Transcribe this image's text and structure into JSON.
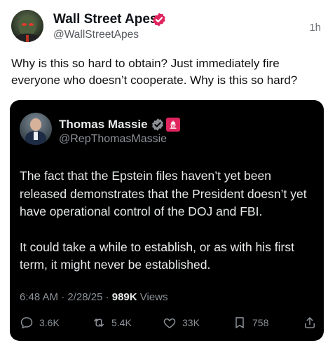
{
  "post": {
    "author_name": "Wall Street Apes",
    "handle": "@WallStreetApes",
    "time": "1h",
    "text": "Why is this so hard to obtain? Just immediately fire everyone who doesn’t cooperate. Why is this so hard?"
  },
  "quoted": {
    "author_name": "Thomas Massie",
    "handle": "@RepThomasMassie",
    "paragraph1": "The fact that the Epstein files haven’t yet been released demonstrates that the President doesn’t yet have operational control of the DOJ and FBI.",
    "paragraph2": "It could take a while to establish, or as with his first term, it might never be established.",
    "timestamp": "6:48 AM · 2/28/25 · ",
    "views_count": "989K",
    "views_label": " Views",
    "stats": {
      "replies": "3.6K",
      "reposts": "5.4K",
      "likes": "33K",
      "bookmarks": "758"
    }
  },
  "colors": {
    "verified_badge_author": "#e0245e",
    "verified_badge_quoted": "#8b9197",
    "card_background": "#000000"
  },
  "icons": [
    "verified-badge-icon",
    "government-badge-icon",
    "reply-icon",
    "repost-icon",
    "like-icon",
    "bookmark-icon",
    "share-icon"
  ]
}
